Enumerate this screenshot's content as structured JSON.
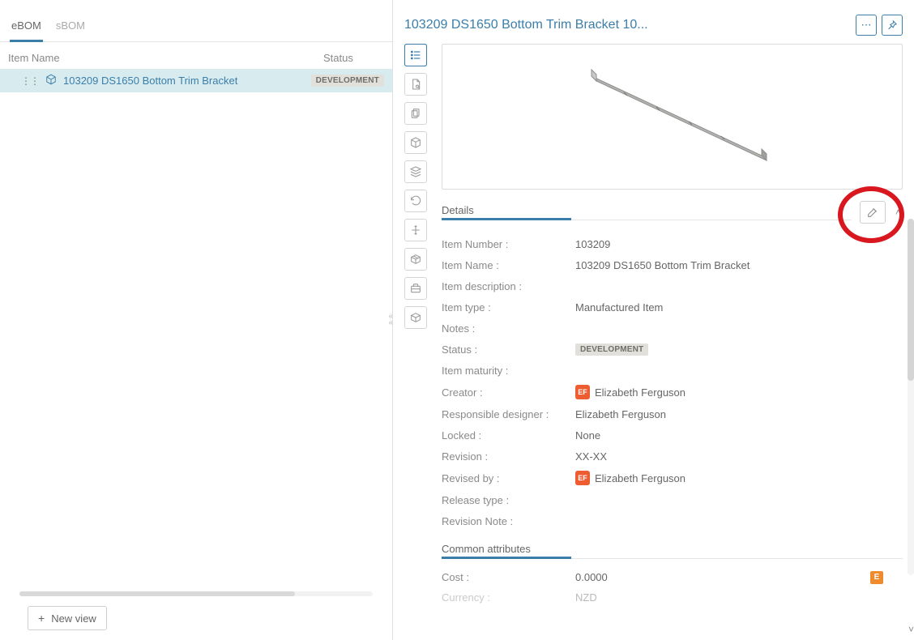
{
  "tabs": {
    "ebom": "eBOM",
    "sbom": "sBOM"
  },
  "tree": {
    "header_name": "Item Name",
    "header_status": "Status",
    "row": {
      "label": "103209 DS1650 Bottom Trim Bracket",
      "status": "DEVELOPMENT"
    }
  },
  "new_view_label": "New view",
  "right": {
    "title": "103209 DS1650 Bottom Trim Bracket 10...",
    "details_heading": "Details",
    "common_heading": "Common attributes",
    "labels": {
      "item_number": "Item Number :",
      "item_name": "Item Name :",
      "item_description": "Item description :",
      "item_type": "Item type :",
      "notes": "Notes :",
      "status": "Status :",
      "item_maturity": "Item maturity :",
      "creator": "Creator :",
      "responsible_designer": "Responsible designer :",
      "locked": "Locked :",
      "revision": "Revision :",
      "revised_by": "Revised by :",
      "release_type": "Release type :",
      "revision_note": "Revision Note :",
      "cost": "Cost :",
      "currency": "Currency :"
    },
    "values": {
      "item_number": "103209",
      "item_name": "103209 DS1650 Bottom Trim Bracket",
      "item_type": "Manufactured Item",
      "status": "DEVELOPMENT",
      "creator": "Elizabeth Ferguson",
      "responsible_designer": "Elizabeth Ferguson",
      "locked": "None",
      "revision": "XX-XX",
      "revised_by": "Elizabeth Ferguson",
      "cost": "0.0000",
      "currency": "NZD"
    },
    "avatar_initials": "EF",
    "e_badge": "E"
  }
}
